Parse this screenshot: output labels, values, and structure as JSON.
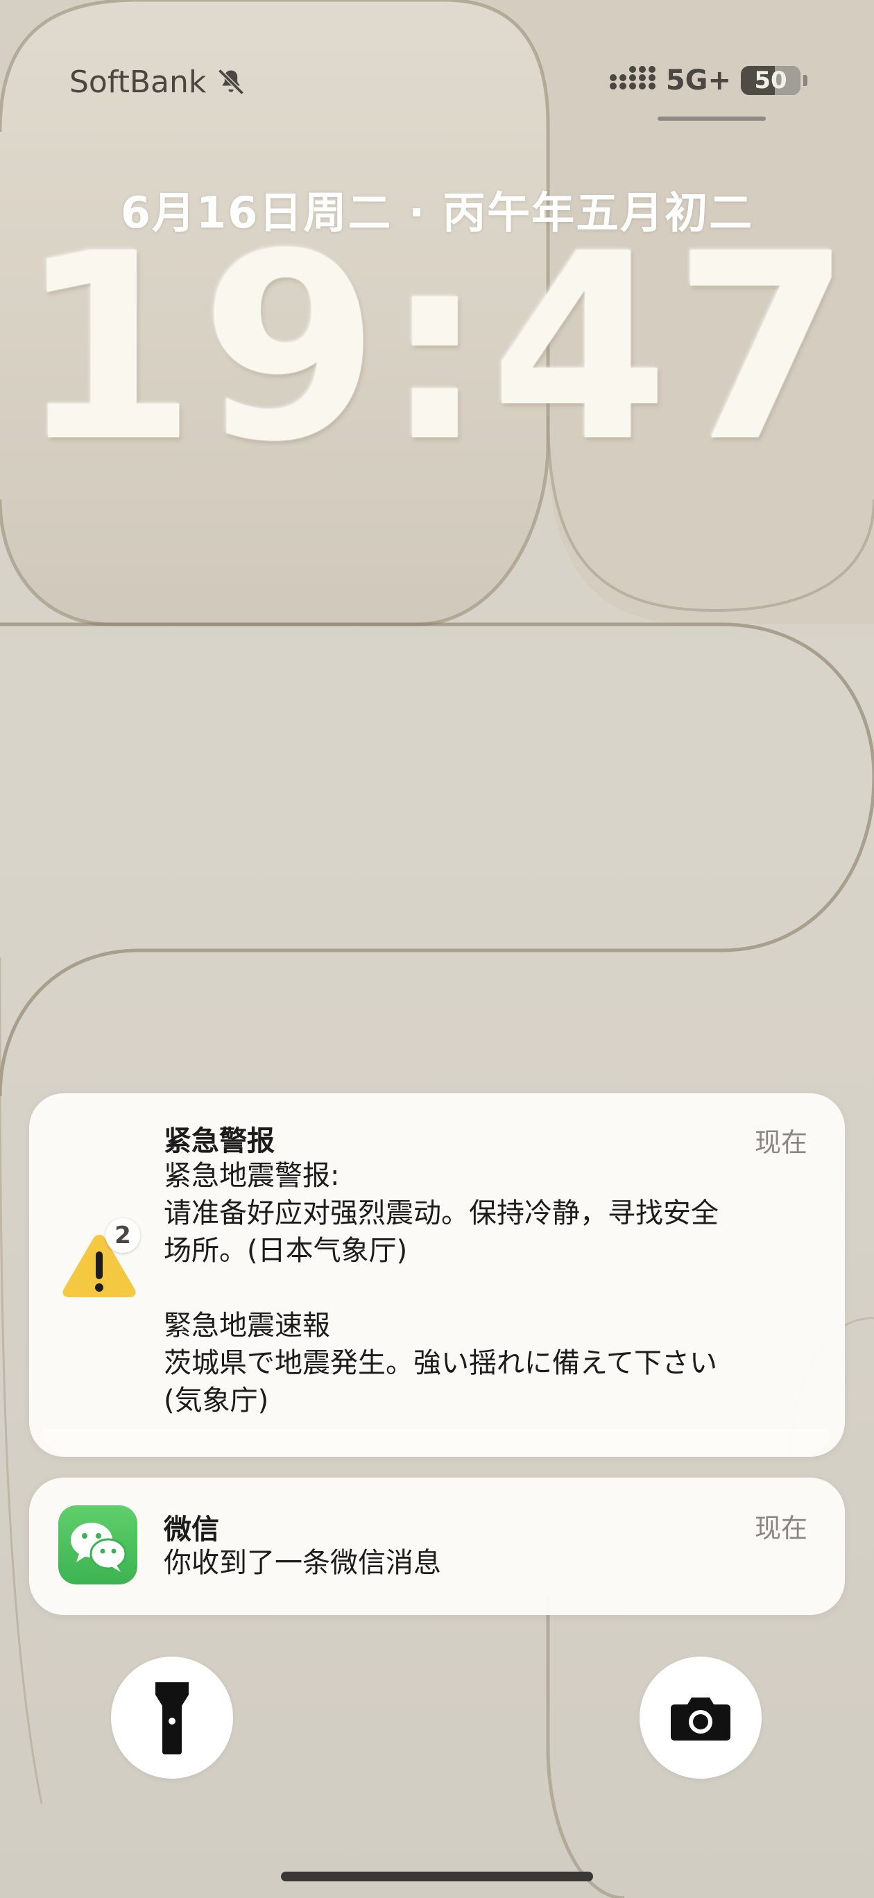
{
  "status_bar": {
    "carrier": "SoftBank",
    "network": "5G+",
    "battery": "50",
    "silent_icon": "bell-slash-icon",
    "signal_icon": "signal-dots-icon"
  },
  "lock_screen": {
    "date": "6月16日周二 · 丙午年五月初二",
    "time": "19:47"
  },
  "notifications": [
    {
      "app": "紧急警报",
      "time": "现在",
      "icon": "warning-icon",
      "count": "2",
      "body": "紧急地震警报:\n请准备好应对强烈震动。保持冷静，寻找安全\n场所。(日本气象厅)\n\n緊急地震速報\n茨城県で地震発生。強い揺れに備えて下さい\n(気象庁)"
    },
    {
      "app": "微信",
      "time": "现在",
      "icon": "wechat-icon",
      "body": "你收到了一条微信消息"
    }
  ],
  "quick_actions": {
    "left": "flashlight-icon",
    "right": "camera-icon"
  },
  "colors": {
    "warning_yellow": "#f5c842",
    "wechat_green": "#3cb351",
    "wallpaper": "#d7d2c8"
  }
}
